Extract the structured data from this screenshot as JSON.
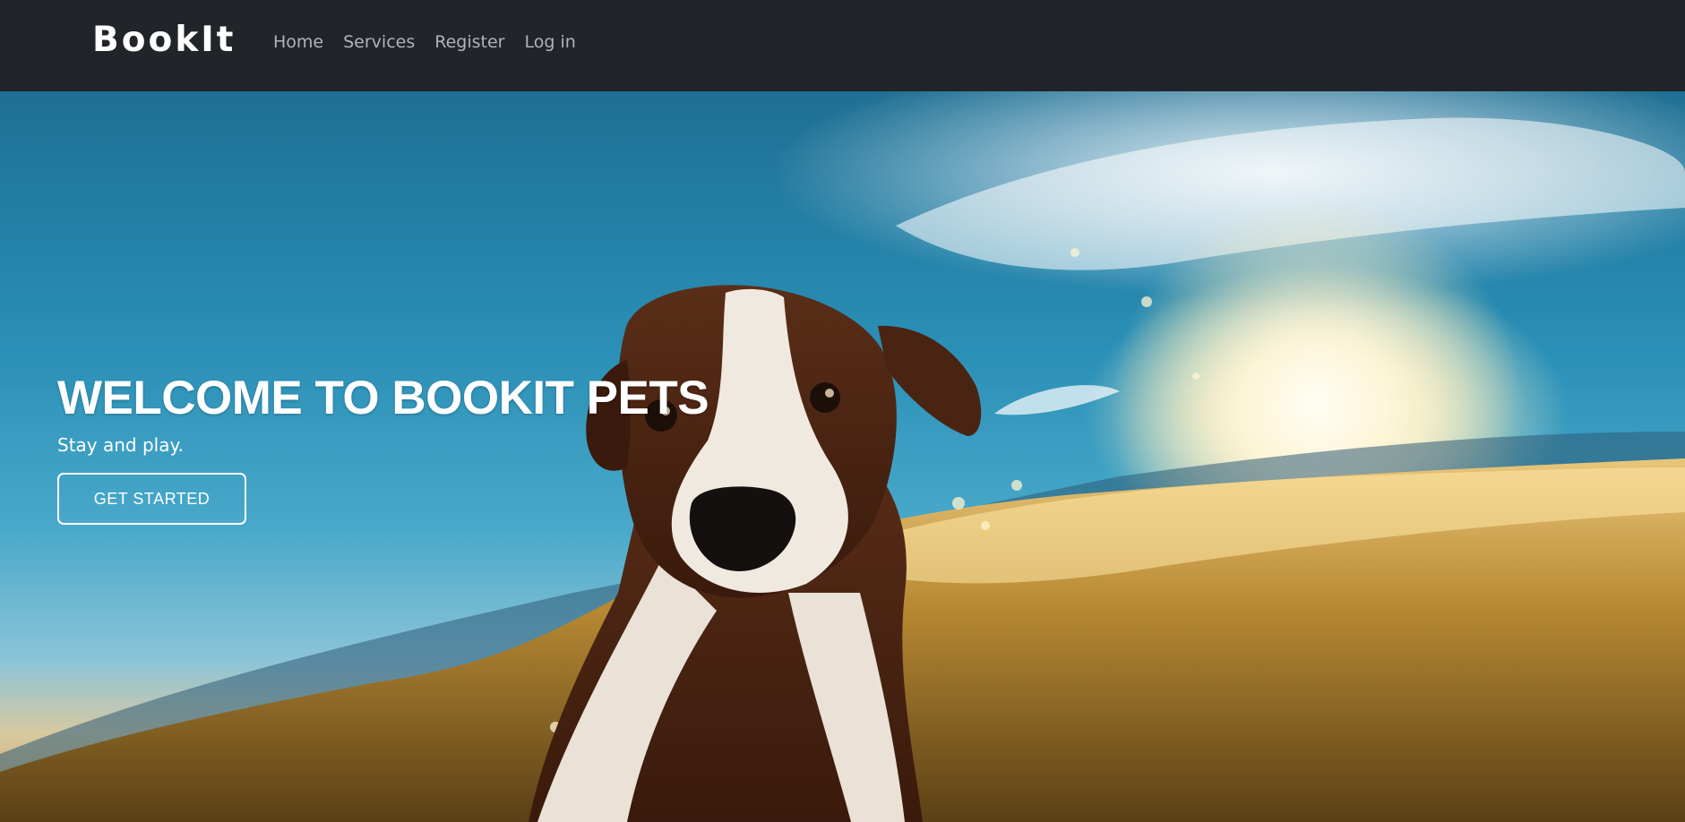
{
  "navbar": {
    "brand": "BookIt",
    "links": [
      {
        "label": "Home"
      },
      {
        "label": "Services"
      },
      {
        "label": "Register"
      },
      {
        "label": "Log in"
      }
    ],
    "background_color": "#212428",
    "link_color": "#b0b3b8"
  },
  "hero": {
    "title": "WELCOME TO BOOKIT PETS",
    "subtitle": "Stay and play.",
    "cta_label": "GET STARTED",
    "background_image": "photo of a puppy surfing a wave under a bright sun"
  }
}
